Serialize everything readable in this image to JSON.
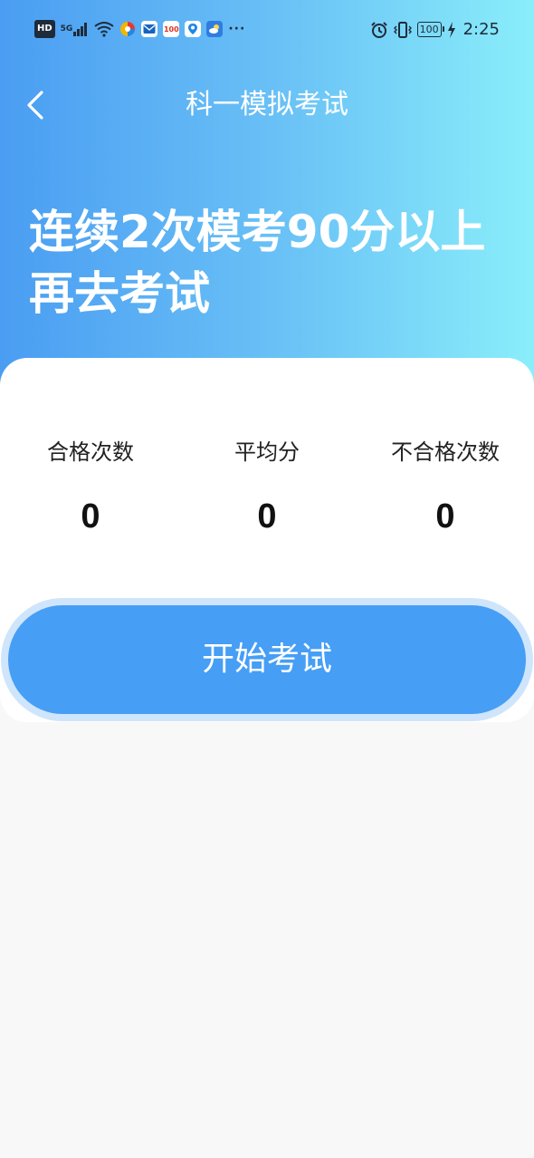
{
  "status_bar": {
    "hd": "HD",
    "network": "5G",
    "time": "2:25",
    "battery": "100",
    "app_icon_text": "100",
    "more": "···"
  },
  "nav": {
    "title": "科一模拟考试"
  },
  "headline": "连续2次模考90分以上\n再去考试",
  "stats": [
    {
      "label": "合格次数",
      "value": "0"
    },
    {
      "label": "平均分",
      "value": "0"
    },
    {
      "label": "不合格次数",
      "value": "0"
    }
  ],
  "start_button": {
    "label": "开始考试"
  },
  "colors": {
    "gradient_start": "#4a9df2",
    "gradient_end": "#8aeefa",
    "button": "#469ef5",
    "button_ring": "#cfe5fb",
    "page_bg": "#f8f8f8"
  }
}
